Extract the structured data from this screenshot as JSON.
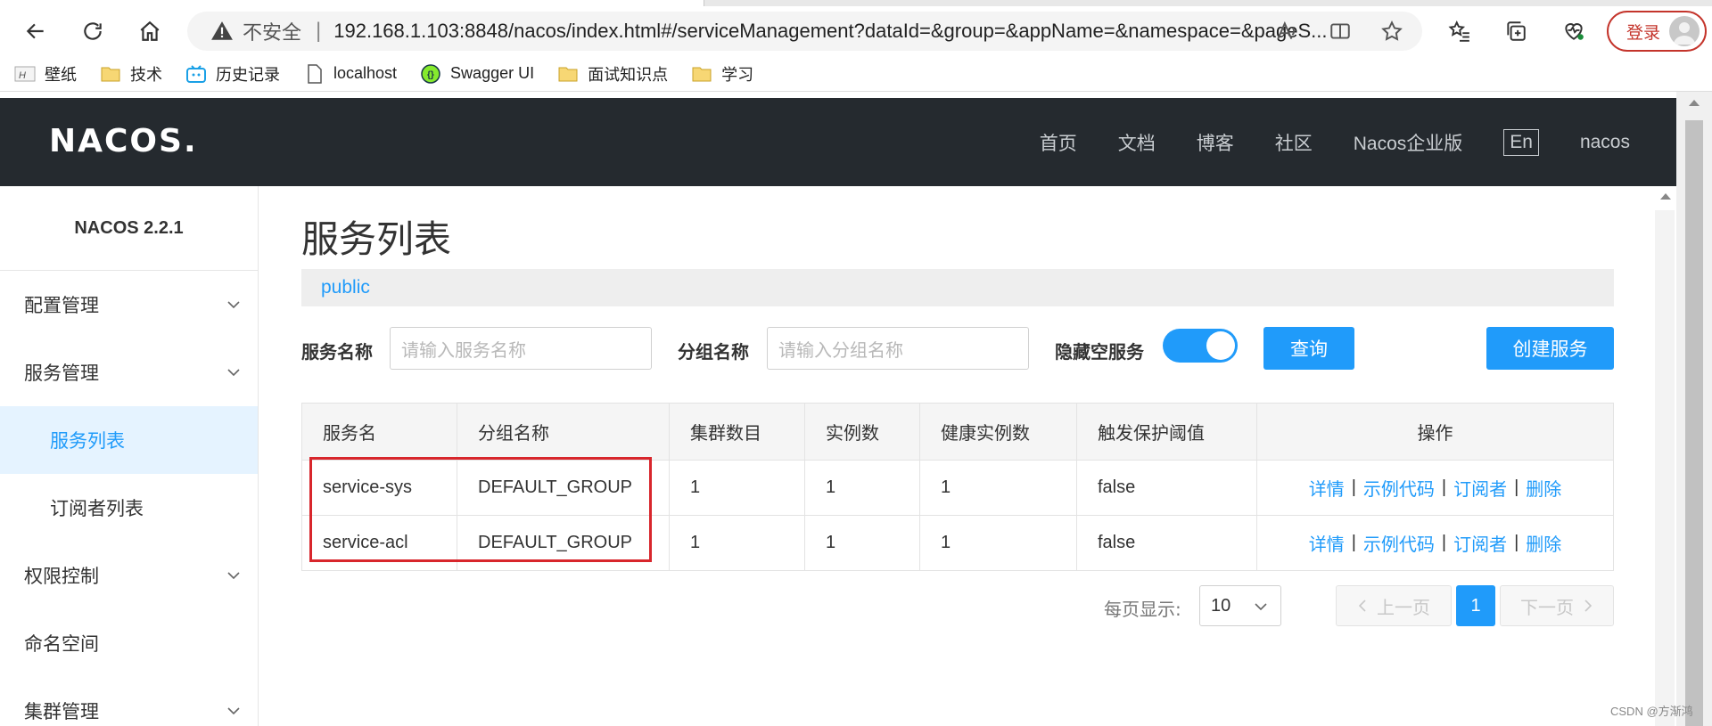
{
  "browser": {
    "insecure_label": "不安全",
    "separator": "|",
    "url": "192.168.1.103:8848/nacos/index.html#/serviceManagement?dataId=&group=&appName=&namespace=&pageS...",
    "login_label": "登录",
    "bookmarks": [
      {
        "label": "壁纸",
        "icon": "wallpaper-icon"
      },
      {
        "label": "技术",
        "icon": "folder-icon"
      },
      {
        "label": "历史记录",
        "icon": "bilibili-icon"
      },
      {
        "label": "localhost",
        "icon": "page-icon"
      },
      {
        "label": "Swagger UI",
        "icon": "swagger-icon"
      },
      {
        "label": "面试知识点",
        "icon": "folder-icon"
      },
      {
        "label": "学习",
        "icon": "folder-icon"
      }
    ]
  },
  "header": {
    "logo": "NACOS.",
    "nav": [
      "首页",
      "文档",
      "博客",
      "社区",
      "Nacos企业版"
    ],
    "lang": "En",
    "user": "nacos"
  },
  "sidebar": {
    "version": "NACOS 2.2.1",
    "items": [
      {
        "label": "配置管理",
        "expandable": true
      },
      {
        "label": "服务管理",
        "expandable": true
      },
      {
        "label": "服务列表",
        "sub": true,
        "active": true
      },
      {
        "label": "订阅者列表",
        "sub": true
      },
      {
        "label": "权限控制",
        "expandable": true
      },
      {
        "label": "命名空间"
      },
      {
        "label": "集群管理",
        "expandable": true
      }
    ]
  },
  "main": {
    "title": "服务列表",
    "namespace": "public",
    "filters": {
      "service_name_label": "服务名称",
      "service_name_placeholder": "请输入服务名称",
      "group_name_label": "分组名称",
      "group_name_placeholder": "请输入分组名称",
      "hide_empty_label": "隐藏空服务",
      "hide_empty_on": true,
      "query_label": "查询",
      "create_label": "创建服务"
    },
    "table": {
      "columns": [
        "服务名",
        "分组名称",
        "集群数目",
        "实例数",
        "健康实例数",
        "触发保护阈值",
        "操作"
      ],
      "rows": [
        {
          "name": "service-sys",
          "group": "DEFAULT_GROUP",
          "clusters": "1",
          "instances": "1",
          "healthy": "1",
          "threshold": "false"
        },
        {
          "name": "service-acl",
          "group": "DEFAULT_GROUP",
          "clusters": "1",
          "instances": "1",
          "healthy": "1",
          "threshold": "false"
        }
      ],
      "ops": [
        "详情",
        "示例代码",
        "订阅者",
        "删除"
      ]
    },
    "pagination": {
      "per_page_label": "每页显示:",
      "page_size": "10",
      "prev_label": "上一页",
      "next_label": "下一页",
      "current_page": "1"
    }
  },
  "watermark": "CSDN @方渐鸿",
  "colors": {
    "accent": "#209bfa",
    "header_bg": "#252a2f",
    "highlight": "#d8262c"
  }
}
